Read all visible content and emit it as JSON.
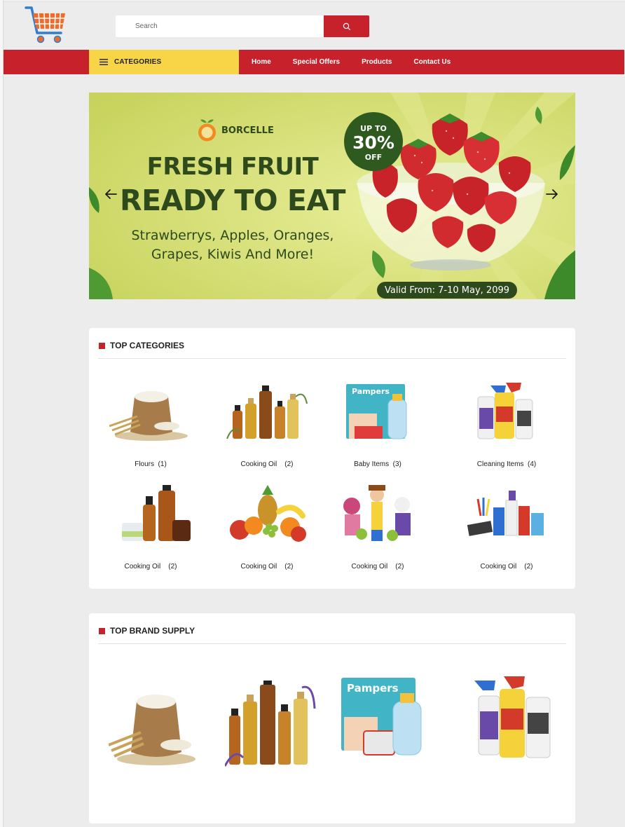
{
  "search": {
    "placeholder": "Search"
  },
  "nav": {
    "categories_label": "CATEGORIES",
    "links": [
      "Home",
      "Special Offers",
      "Products",
      "Contact Us"
    ]
  },
  "banner": {
    "brand": "BORCELLE",
    "headline_1": "FRESH FRUIT",
    "headline_2": "READY TO EAT",
    "sub_1": "Strawberrys, Apples, Oranges,",
    "sub_2": "Grapes, Kiwis And More!",
    "badge_top": "UP TO",
    "badge_mid": "30%",
    "badge_bot": "OFF",
    "valid": "Valid From: 7-10 May, 2099"
  },
  "top_categories": {
    "title": "TOP CATEGORIES",
    "items": [
      {
        "label": "Flours  (1)",
        "icon": "flour-sack-image"
      },
      {
        "label": "Cooking Oil    (2)",
        "icon": "oil-bottles-image"
      },
      {
        "label": "Baby Items  (3)",
        "icon": "baby-products-image"
      },
      {
        "label": "Cleaning Items  (4)",
        "icon": "cleaning-bottles-image"
      },
      {
        "label": "Cooking Oil    (2)",
        "icon": "cosmetics-bottles-image"
      },
      {
        "label": "Cooking Oil    (2)",
        "icon": "fruit-pile-image"
      },
      {
        "label": "Cooking Oil    (2)",
        "icon": "toys-image"
      },
      {
        "label": "Cooking Oil    (2)",
        "icon": "stationery-image"
      }
    ]
  },
  "top_brands": {
    "title": "TOP BRAND SUPPLY",
    "items": [
      {
        "icon": "flour-sack-image"
      },
      {
        "icon": "oil-bottles-image"
      },
      {
        "icon": "baby-products-image"
      },
      {
        "icon": "cleaning-bottles-image"
      }
    ]
  },
  "colors": {
    "brand_red": "#c7222c",
    "categories_yellow": "#f7d546",
    "banner_green": "#cfd86a",
    "banner_text": "#2e4a1c",
    "page_bg": "#ececec"
  }
}
